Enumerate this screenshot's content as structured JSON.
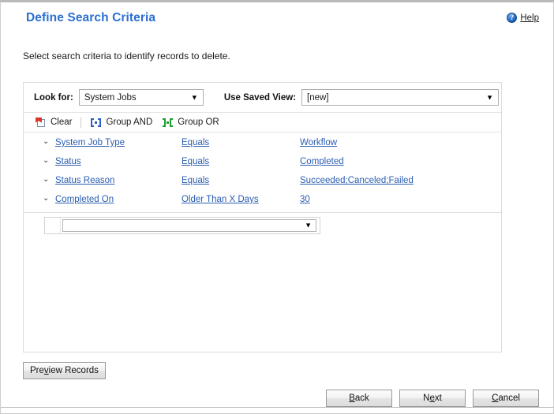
{
  "header": {
    "title": "Define Search Criteria",
    "help_label": "Help",
    "help_icon": "question-circle-icon"
  },
  "subtitle": "Select search criteria to identify records to delete.",
  "lookfor": {
    "label": "Look for:",
    "value": "System Jobs",
    "arrow": "▼"
  },
  "saved_view": {
    "label": "Use Saved View:",
    "value": "[new]",
    "arrow": "▼"
  },
  "toolbar": {
    "clear_label": "Clear",
    "group_and_label": "Group AND",
    "group_or_label": "Group OR",
    "clear_icon": "clear-filter-icon",
    "group_and_icon": "group-and-brackets-icon",
    "group_or_icon": "group-or-brackets-icon"
  },
  "criteria_rows": [
    {
      "chevron": "⌄",
      "field": "System Job Type",
      "operator": "Equals",
      "value": "Workflow"
    },
    {
      "chevron": "⌄",
      "field": "Status",
      "operator": "Equals",
      "value": "Completed"
    },
    {
      "chevron": "⌄",
      "field": "Status Reason",
      "operator": "Equals",
      "value": "Succeeded;Canceled;Failed"
    },
    {
      "chevron": "⌄",
      "field": "Completed On",
      "operator": "Older Than X Days",
      "value": "30"
    }
  ],
  "new_row": {
    "value": "",
    "placeholder": "",
    "arrow": "▼"
  },
  "buttons": {
    "preview_pre": "Pre",
    "preview_acc": "v",
    "preview_post": "iew Records",
    "back_acc": "B",
    "back_post": "ack",
    "next_pre": "N",
    "next_acc": "e",
    "next_post": "xt",
    "cancel_acc": "C",
    "cancel_post": "ancel"
  },
  "colors": {
    "title_blue": "#2a6fd1",
    "link_blue": "#2a5db0",
    "group_and": "#2b5fc4",
    "group_or": "#1f9e32",
    "clear_red": "#d8362a"
  }
}
